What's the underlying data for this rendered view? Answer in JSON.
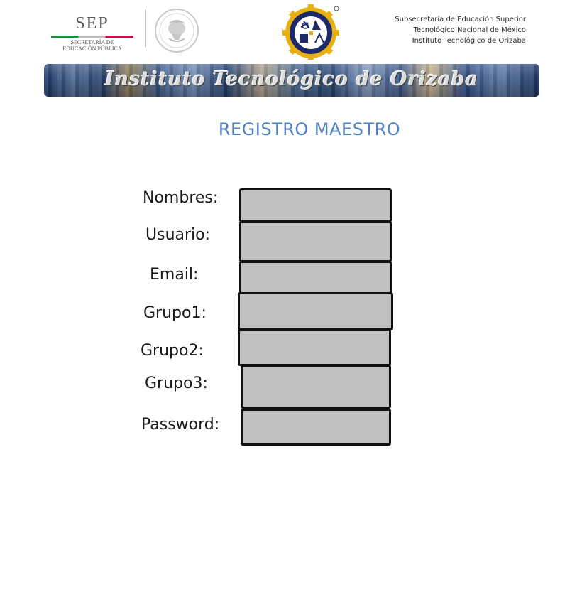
{
  "header": {
    "sep_logo": {
      "acronym": "SEP",
      "subtitle_line1": "SECRETARÍA DE",
      "subtitle_line2": "EDUCACIÓN PÚBLICA",
      "stripe_colors": [
        "#1e8a3a",
        "#bdbdbd",
        "#b7194a"
      ]
    },
    "seal_icon": "mexican-coat-of-arms-icon",
    "institute_logo_icon": "ito-gear-logo-icon",
    "org_lines": [
      "Subsecretaría de Educación Superior",
      "Tecnológico Nacional de México",
      "Instituto Tecnológico de Orizaba"
    ],
    "banner_title": "Instituto Tecnológico de Orizaba"
  },
  "form": {
    "title": "REGISTRO MAESTRO",
    "title_color": "#4f7fc4",
    "input_background": "#c0c0c0",
    "fields": [
      {
        "label": "Nombres:",
        "value": ""
      },
      {
        "label": "Usuario:",
        "value": ""
      },
      {
        "label": "Email:",
        "value": ""
      },
      {
        "label": "Grupo1:",
        "value": ""
      },
      {
        "label": "Grupo2:",
        "value": ""
      },
      {
        "label": "Grupo3:",
        "value": ""
      },
      {
        "label": "Password:",
        "value": ""
      }
    ]
  }
}
